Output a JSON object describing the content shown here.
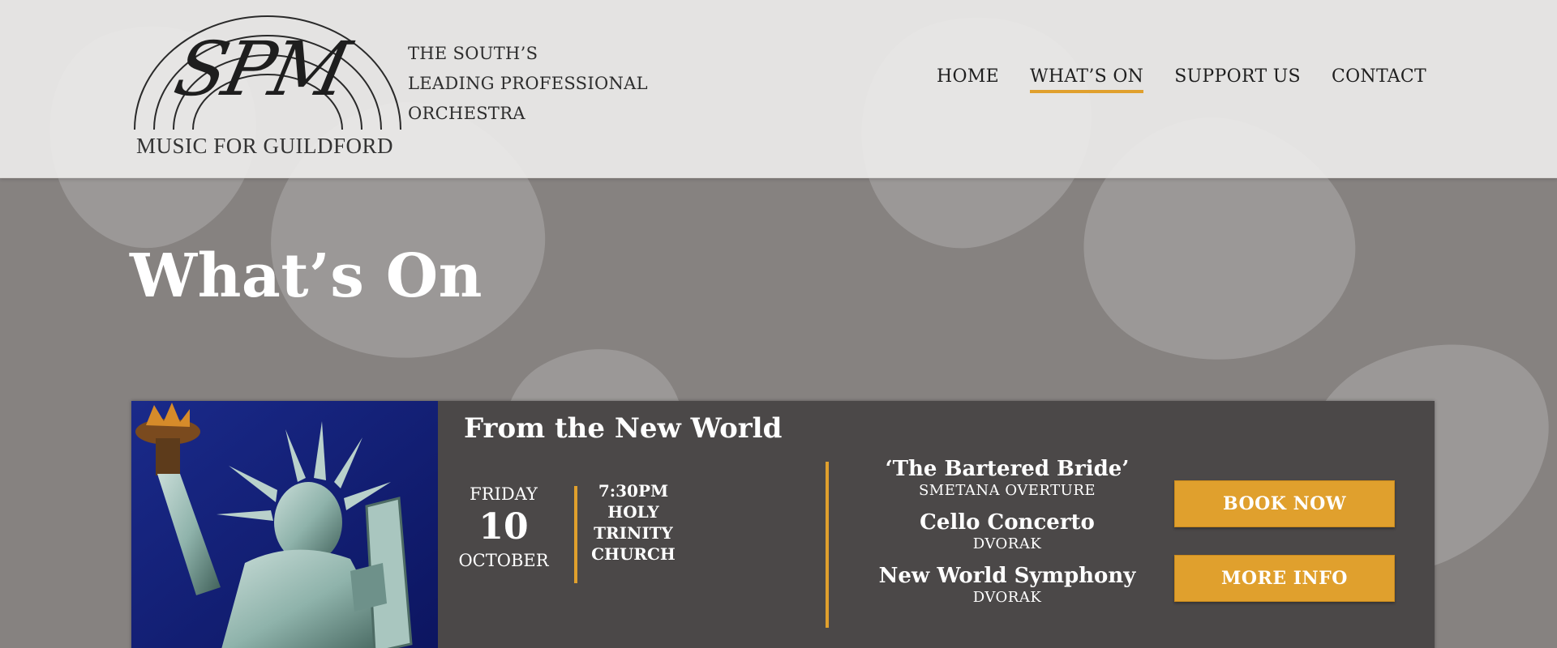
{
  "brand": {
    "monogram": "SPM",
    "subtitle": "MUSIC FOR GUILDFORD",
    "tagline": [
      "THE SOUTH’S",
      "LEADING PROFESSIONAL",
      "ORCHESTRA"
    ]
  },
  "nav": {
    "items": [
      {
        "label": "HOME",
        "active": false
      },
      {
        "label": "WHAT’S ON",
        "active": true
      },
      {
        "label": "SUPPORT US",
        "active": false
      },
      {
        "label": "CONTACT",
        "active": false
      }
    ]
  },
  "page": {
    "title": "What’s On"
  },
  "event": {
    "title": "From the New World",
    "date": {
      "day": "FRIDAY",
      "number": "10",
      "month": "OCTOBER"
    },
    "time_venue": [
      "7:30PM",
      "HOLY",
      "TRINITY",
      "CHURCH"
    ],
    "program": [
      {
        "title": "‘The Bartered Bride’",
        "subtitle": "SMETANA OVERTURE"
      },
      {
        "title": "Cello Concerto",
        "subtitle": "DVORAK"
      },
      {
        "title": "New World Symphony",
        "subtitle": "DVORAK"
      }
    ],
    "book_label": "BOOK NOW",
    "info_label": "MORE INFO",
    "image_icon": "statue-of-liberty-image"
  },
  "colors": {
    "accent": "#e0a02d",
    "header_bg": "#ecebe9",
    "page_bg": "#868280",
    "card_bg": "#4b4848"
  }
}
